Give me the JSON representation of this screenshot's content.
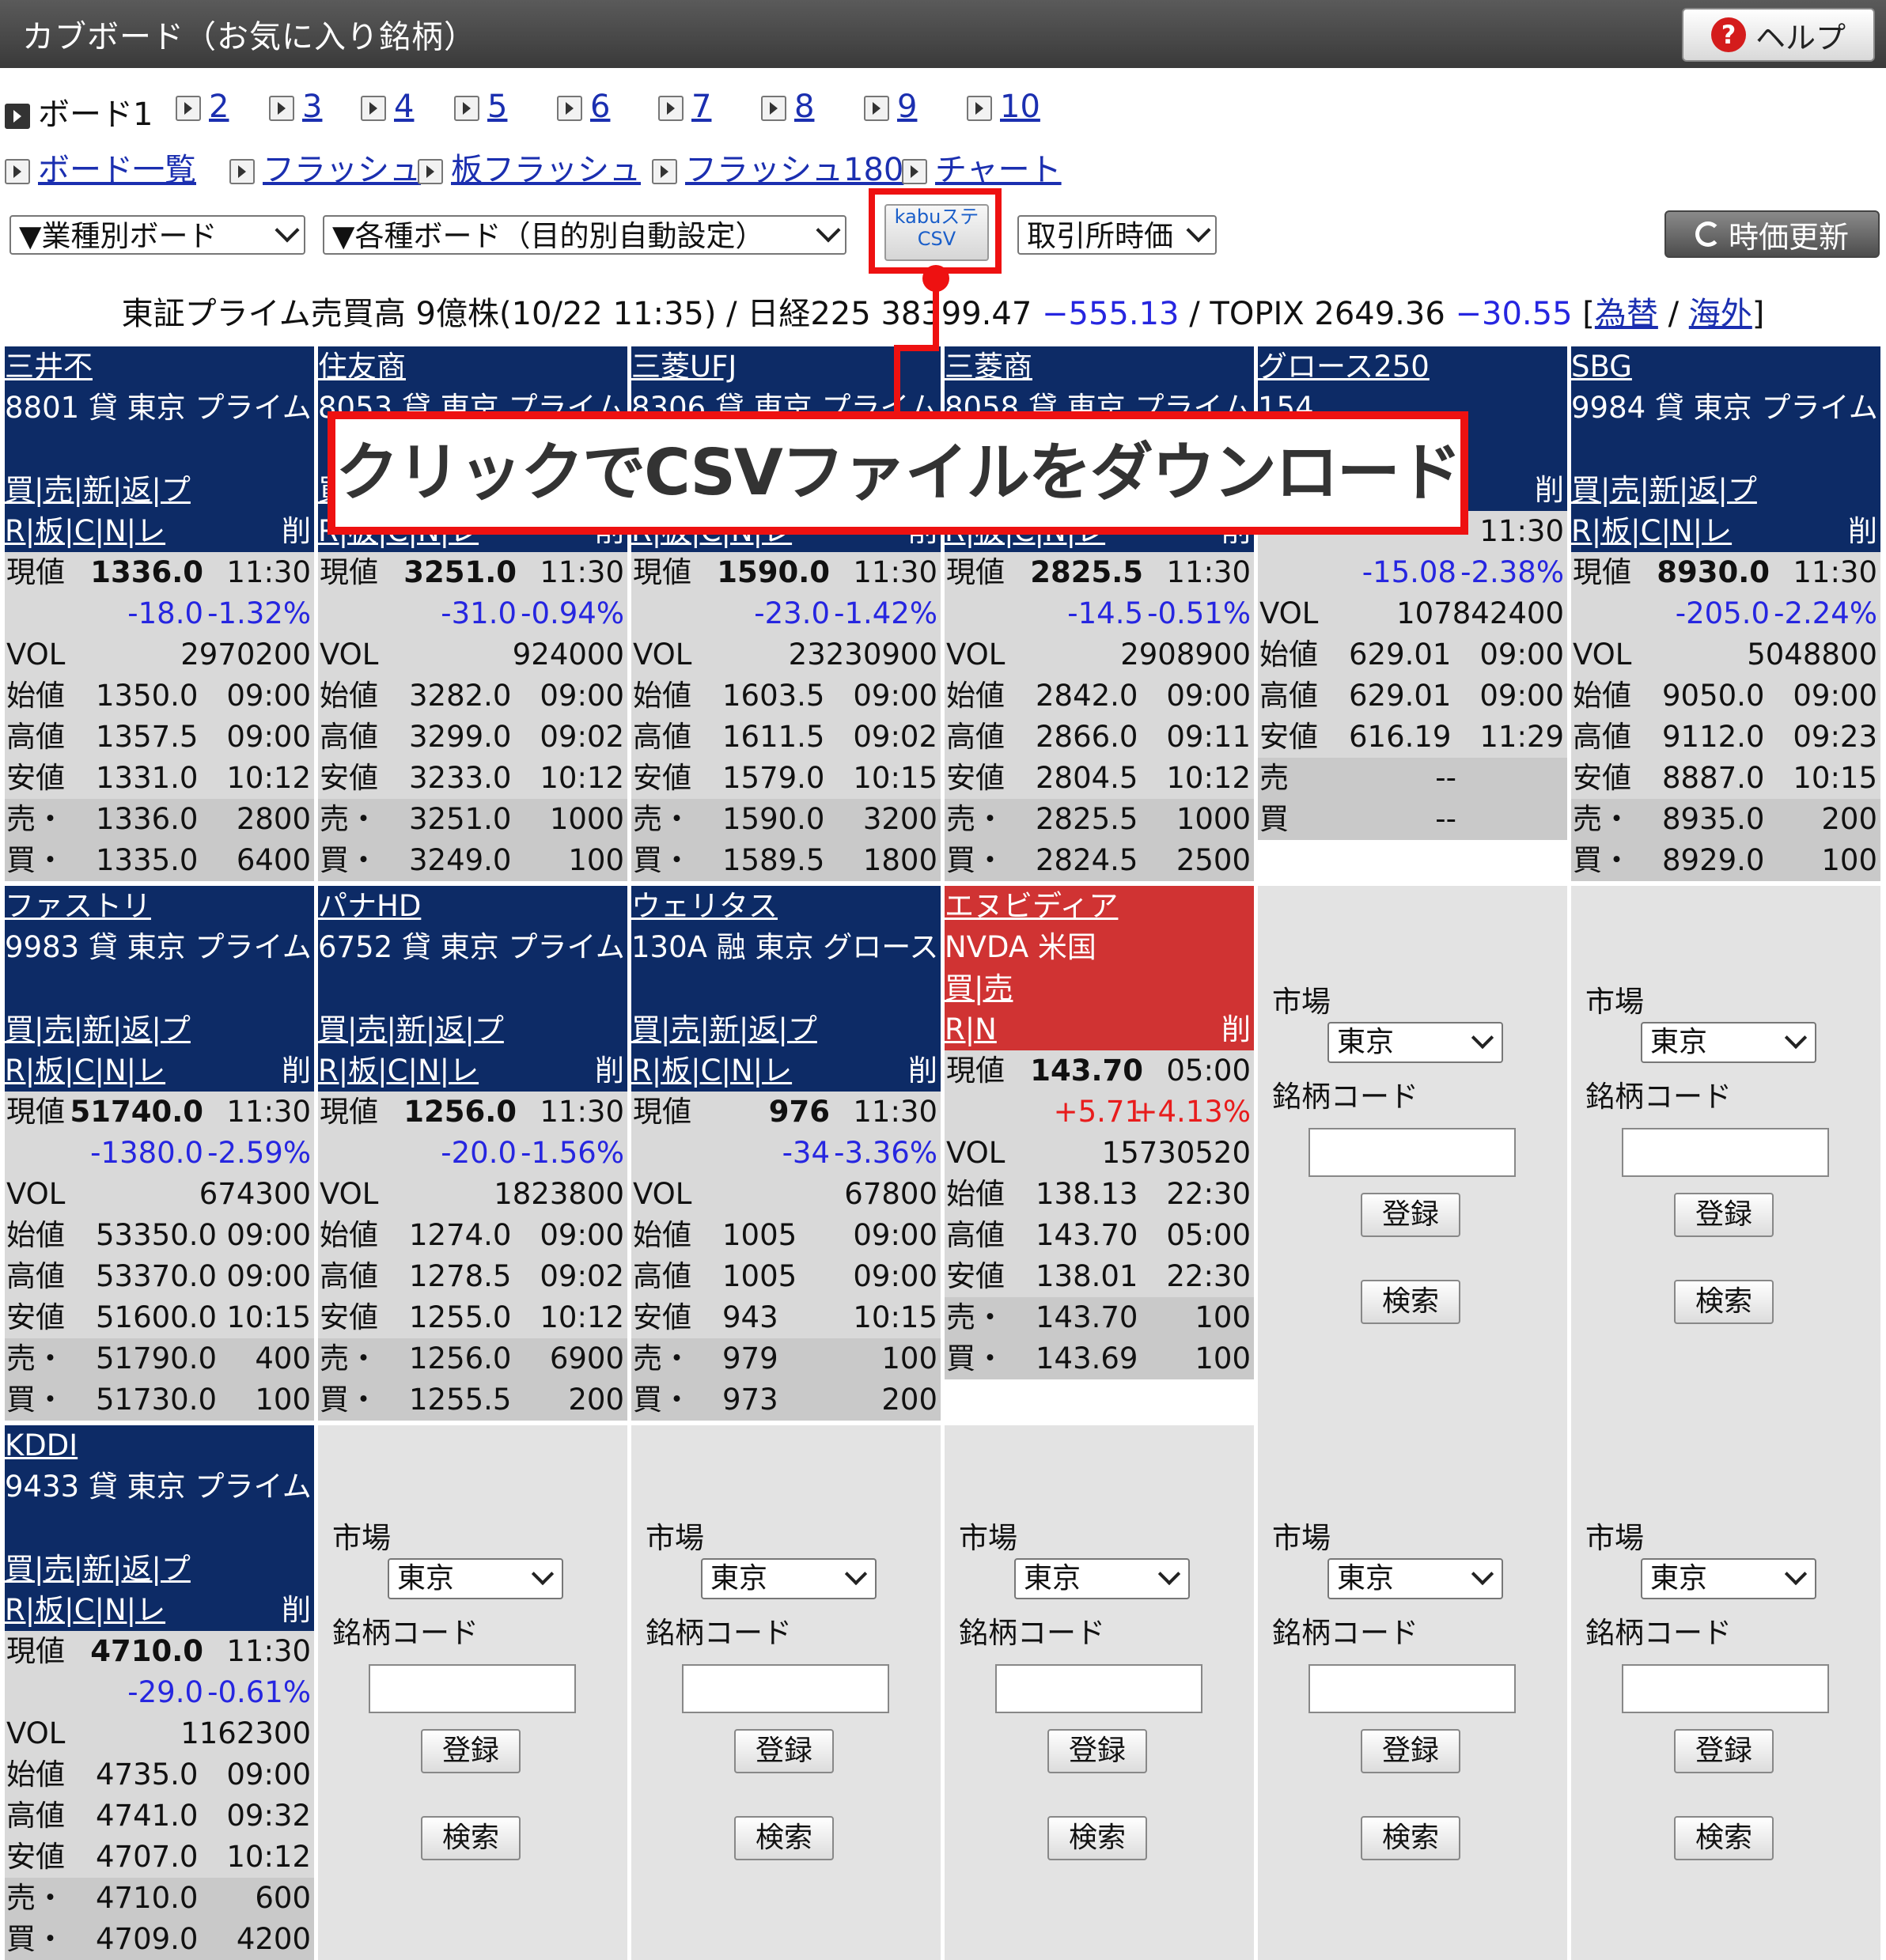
{
  "title": "カブボード（お気に入り銘柄）",
  "help_label": "ヘルプ",
  "boards": {
    "current": "ボード1",
    "others": [
      "2",
      "3",
      "4",
      "5",
      "6",
      "7",
      "8",
      "9",
      "10"
    ]
  },
  "links": [
    "ボード一覧",
    "フラッシュ",
    "板フラッシュ",
    "フラッシュ180",
    "チャート"
  ],
  "toolbar": {
    "sector_select": "▼業種別ボード",
    "purpose_select": "▼各種ボード（目的別自動設定）",
    "csv_button_line1": "kabuステ",
    "csv_button_line2": "CSV",
    "price_select": "取引所時価",
    "refresh_label": "時価更新"
  },
  "market": {
    "prime_text": "東証プライム売買高",
    "prime_volume": "9",
    "prime_unit": "億株",
    "timestamp": "(10/22 11:35)",
    "nikkei_label": "日経225",
    "nikkei_value": "38399.47",
    "nikkei_change": "−555.13",
    "topix_label": "TOPIX",
    "topix_value": "2649.36",
    "topix_change": "−30.55",
    "fx_link": "為替",
    "overseas_link": "海外"
  },
  "callout_text": "クリックでCSVファイルをダウンロード",
  "labels": {
    "current": "現値",
    "vol": "VOL",
    "open": "始値",
    "high": "高値",
    "low": "安値",
    "ask": "売・",
    "bid": "買・",
    "ask_plain": "売",
    "bid_plain": "買",
    "actions": "買|売|新|返|プ",
    "actions_us": "買|売",
    "tools": "R|板|C|N|レ",
    "tools_us": "R|N",
    "delete": "削",
    "market": "市場",
    "market_value": "東京",
    "code": "銘柄コード",
    "register": "登録",
    "search": "検索"
  },
  "stocks": [
    {
      "name": "三井不",
      "info": "8801 貸 東京 プライム",
      "price": "1336.0",
      "time": "11:30",
      "chg": "-18.0",
      "pct": "-1.32%",
      "vol": "2970200",
      "open": "1350.0",
      "open_t": "09:00",
      "high": "1357.5",
      "high_t": "09:00",
      "low": "1331.0",
      "low_t": "10:12",
      "ask": "1336.0",
      "ask_q": "2800",
      "bid": "1335.0",
      "bid_q": "6400"
    },
    {
      "name": "住友商",
      "info": "8053 貸 東京 プライム",
      "price": "3251.0",
      "time": "11:30",
      "chg": "-31.0",
      "pct": "-0.94%",
      "vol": "924000",
      "open": "3282.0",
      "open_t": "09:00",
      "high": "3299.0",
      "high_t": "09:02",
      "low": "3233.0",
      "low_t": "10:12",
      "ask": "3251.0",
      "ask_q": "1000",
      "bid": "3249.0",
      "bid_q": "100"
    },
    {
      "name": "三菱UFJ",
      "info": "8306 貸 東京 プライム",
      "price": "1590.0",
      "time": "11:30",
      "chg": "-23.0",
      "pct": "-1.42%",
      "vol": "23230900",
      "open": "1603.5",
      "open_t": "09:00",
      "high": "1611.5",
      "high_t": "09:02",
      "low": "1579.0",
      "low_t": "10:15",
      "ask": "1590.0",
      "ask_q": "3200",
      "bid": "1589.5",
      "bid_q": "1800"
    },
    {
      "name": "三菱商",
      "info": "8058 貸 東京 プライム",
      "price": "2825.5",
      "time": "11:30",
      "chg": "-14.5",
      "pct": "-0.51%",
      "vol": "2908900",
      "open": "2842.0",
      "open_t": "09:00",
      "high": "2866.0",
      "high_t": "09:11",
      "low": "2804.5",
      "low_t": "10:12",
      "ask": "2825.5",
      "ask_q": "1000",
      "bid": "2824.5",
      "bid_q": "2500"
    },
    {
      "name": "SBG",
      "info": "9984 貸 東京 プライム",
      "price": "8930.0",
      "time": "11:30",
      "chg": "-205.0",
      "pct": "-2.24%",
      "vol": "5048800",
      "open": "9050.0",
      "open_t": "09:00",
      "high": "9112.0",
      "high_t": "09:23",
      "low": "8887.0",
      "low_t": "10:15",
      "ask": "8935.0",
      "ask_q": "200",
      "bid": "8929.0",
      "bid_q": "100"
    },
    {
      "name": "ファストリ",
      "info": "9983 貸 東京 プライム",
      "price": "51740.0",
      "time": "11:30",
      "chg": "-1380.0",
      "pct": "-2.59%",
      "vol": "674300",
      "open": "53350.0",
      "open_t": "09:00",
      "high": "53370.0",
      "high_t": "09:00",
      "low": "51600.0",
      "low_t": "10:15",
      "ask": "51790.0",
      "ask_q": "400",
      "bid": "51730.0",
      "bid_q": "100"
    },
    {
      "name": "パナHD",
      "info": "6752 貸 東京 プライム",
      "price": "1256.0",
      "time": "11:30",
      "chg": "-20.0",
      "pct": "-1.56%",
      "vol": "1823800",
      "open": "1274.0",
      "open_t": "09:00",
      "high": "1278.5",
      "high_t": "09:02",
      "low": "1255.0",
      "low_t": "10:12",
      "ask": "1256.0",
      "ask_q": "6900",
      "bid": "1255.5",
      "bid_q": "200"
    },
    {
      "name": "ウェリタス",
      "info": "130A 融 東京 グロース",
      "price": "976",
      "time": "11:30",
      "chg": "-34",
      "pct": "-3.36%",
      "vol": "67800",
      "open": "1005",
      "open_t": "09:00",
      "high": "1005",
      "high_t": "09:00",
      "low": "943",
      "low_t": "10:15",
      "ask": "979",
      "ask_q": "100",
      "bid": "973",
      "bid_q": "200"
    },
    {
      "name": "KDDI",
      "info": "9433 貸 東京 プライム",
      "price": "4710.0",
      "time": "11:30",
      "chg": "-29.0",
      "pct": "-0.61%",
      "vol": "1162300",
      "open": "4735.0",
      "open_t": "09:00",
      "high": "4741.0",
      "high_t": "09:32",
      "low": "4707.0",
      "low_t": "10:12",
      "ask": "4710.0",
      "ask_q": "600",
      "bid": "4709.0",
      "bid_q": "4200"
    }
  ],
  "index_card": {
    "name": "グロース250",
    "info": "154",
    "time": "11:30",
    "chg": "-15.08",
    "pct": "-2.38%",
    "vol": "107842400",
    "open": "629.01",
    "open_t": "09:00",
    "high": "629.01",
    "high_t": "09:00",
    "low": "616.19",
    "low_t": "11:29",
    "ask": "--",
    "bid": "--"
  },
  "us_card": {
    "name": "エヌビディア",
    "info": "NVDA 米国",
    "price": "143.70",
    "time": "05:00",
    "chg": "+5.71",
    "pct": "+4.13%",
    "vol": "15730520",
    "open": "138.13",
    "open_t": "22:30",
    "high": "143.70",
    "high_t": "05:00",
    "low": "138.01",
    "low_t": "22:30",
    "ask": "143.70",
    "ask_q": "100",
    "bid": "143.69",
    "bid_q": "100"
  },
  "colors": {
    "header_navy": "#0d2b66",
    "header_red": "#d03333",
    "down": "#2626e0",
    "up": "#e81c1c",
    "highlight": "#ee1111"
  }
}
